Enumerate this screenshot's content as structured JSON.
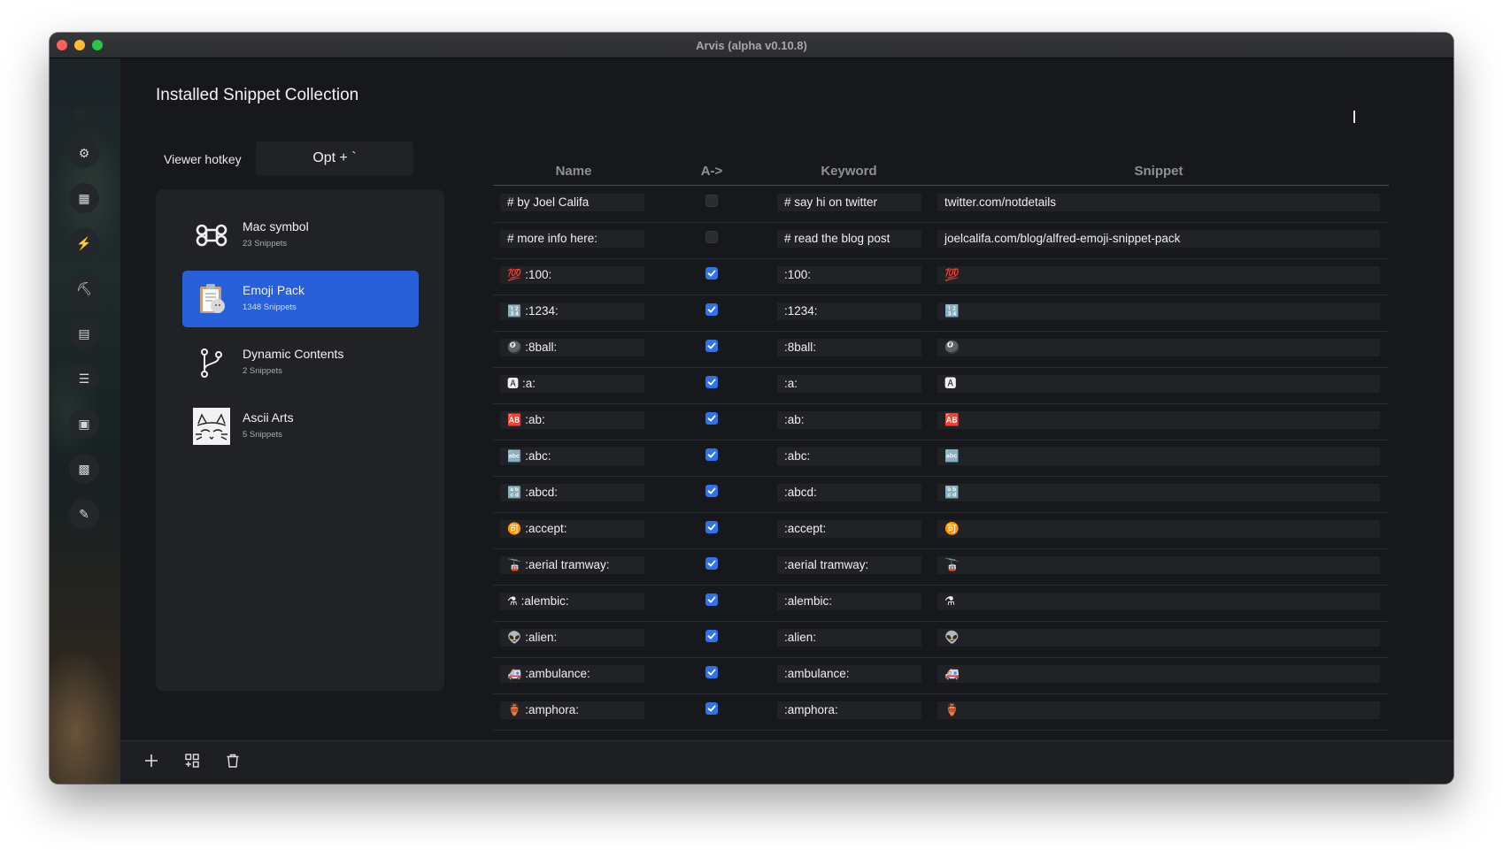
{
  "window": {
    "title": "Arvis (alpha v0.10.8)"
  },
  "sidebar": {
    "items": [
      {
        "icon": "gear-icon",
        "glyph": "⚙"
      },
      {
        "icon": "grid-icon",
        "glyph": "▦"
      },
      {
        "icon": "bolt-icon",
        "glyph": "⚡"
      },
      {
        "icon": "paint-roller-icon",
        "glyph": "⛏"
      },
      {
        "icon": "clipboard-icon",
        "glyph": "▤"
      },
      {
        "icon": "list-icon",
        "glyph": "☰"
      },
      {
        "icon": "snippet-icon",
        "glyph": "▣"
      },
      {
        "icon": "archive-icon",
        "glyph": "▩"
      },
      {
        "icon": "wrench-icon",
        "glyph": "✎"
      }
    ]
  },
  "main": {
    "title": "Installed Snippet Collection",
    "hotkey": {
      "label": "Viewer hotkey",
      "value": "Opt + `"
    }
  },
  "collections": [
    {
      "name": "Mac symbol",
      "count": "23 Snippets",
      "selected": false,
      "icon": "command-icon"
    },
    {
      "name": "Emoji Pack",
      "count": "1348 Snippets",
      "selected": true,
      "icon": "clipboard-emoji-icon"
    },
    {
      "name": "Dynamic Contents",
      "count": "2 Snippets",
      "selected": false,
      "icon": "branch-icon"
    },
    {
      "name": "Ascii Arts",
      "count": "5 Snippets",
      "selected": false,
      "icon": "ascii-cat-icon"
    }
  ],
  "table": {
    "headers": {
      "name": "Name",
      "auto": "A->",
      "keyword": "Keyword",
      "snippet": "Snippet"
    },
    "rows": [
      {
        "icon": "",
        "name": "# by Joel Califa",
        "auto": false,
        "keyword": "# say hi on twitter",
        "snippet": "twitter.com/notdetails"
      },
      {
        "icon": "",
        "name": "# more info here:",
        "auto": false,
        "keyword": "# read the blog post",
        "snippet": "joelcalifa.com/blog/alfred-emoji-snippet-pack"
      },
      {
        "icon": "💯",
        "name": ":100:",
        "auto": true,
        "keyword": ":100:",
        "snippet": "💯"
      },
      {
        "icon": "🔢",
        "name": ":1234:",
        "auto": true,
        "keyword": ":1234:",
        "snippet": "🔢"
      },
      {
        "icon": "🎱",
        "name": ":8ball:",
        "auto": true,
        "keyword": ":8ball:",
        "snippet": "🎱"
      },
      {
        "icon": "🅰",
        "name": ":a:",
        "auto": true,
        "keyword": ":a:",
        "snippet": "🅰"
      },
      {
        "icon": "🆎",
        "name": ":ab:",
        "auto": true,
        "keyword": ":ab:",
        "snippet": "🆎"
      },
      {
        "icon": "🔤",
        "name": ":abc:",
        "auto": true,
        "keyword": ":abc:",
        "snippet": "🔤"
      },
      {
        "icon": "🔡",
        "name": ":abcd:",
        "auto": true,
        "keyword": ":abcd:",
        "snippet": "🔡"
      },
      {
        "icon": "🉑",
        "name": ":accept:",
        "auto": true,
        "keyword": ":accept:",
        "snippet": "🉑"
      },
      {
        "icon": "🚡",
        "name": ":aerial tramway:",
        "auto": true,
        "keyword": ":aerial tramway:",
        "snippet": "🚡"
      },
      {
        "icon": "⚗",
        "name": ":alembic:",
        "auto": true,
        "keyword": ":alembic:",
        "snippet": "⚗"
      },
      {
        "icon": "👽",
        "name": ":alien:",
        "auto": true,
        "keyword": ":alien:",
        "snippet": "👽"
      },
      {
        "icon": "🚑",
        "name": ":ambulance:",
        "auto": true,
        "keyword": ":ambulance:",
        "snippet": "🚑"
      },
      {
        "icon": "🏺",
        "name": ":amphora:",
        "auto": true,
        "keyword": ":amphora:",
        "snippet": "🏺"
      }
    ]
  },
  "bottombar": [
    {
      "icon": "plus-icon",
      "glyph": "+"
    },
    {
      "icon": "grid-add-icon",
      "glyph": "⊞"
    },
    {
      "icon": "trash-icon",
      "glyph": "🗑"
    }
  ],
  "colors": {
    "accent": "#2760d8",
    "checkbox": "#2f73ec",
    "background": "#17181c"
  }
}
